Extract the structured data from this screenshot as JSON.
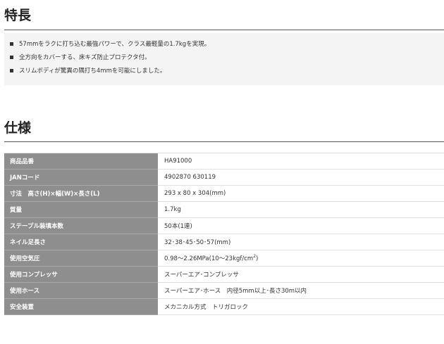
{
  "features": {
    "title": "特長",
    "items": [
      "57mmをラクに打ち込む最強パワーで、クラス最軽量の1.7kgを実現。",
      "全方向をカバーする、床キズ防止プロテクタ付。",
      "スリムボディが驚異の隅打ち4mmを可能にしました。"
    ]
  },
  "specs": {
    "title": "仕様",
    "rows": [
      {
        "label": "商品品番",
        "value": "HA91000"
      },
      {
        "label": "JANコード",
        "value": "4902870 630119"
      },
      {
        "label": "寸法　高さ(H)×幅(W)×長さ(L)",
        "value": "293 x 80 x 304(mm)"
      },
      {
        "label": "質量",
        "value": "1.7kg"
      },
      {
        "label": "ステープル装填本数",
        "value": "50本(1連)"
      },
      {
        "label": "ネイル足長さ",
        "value": "32･38･45･50･57(mm)"
      },
      {
        "label": "使用空気圧",
        "value": "0.98～2.26MPa(10～23kgf/cm",
        "value_sup": "2",
        "value_suffix": ")"
      },
      {
        "label": "使用コンプレッサ",
        "value": "スーパーエア･コンプレッサ"
      },
      {
        "label": "使用ホース",
        "value": "スーパーエア･ホース　内径5mm以上･長さ30m以内"
      },
      {
        "label": "安全装置",
        "value": "メカニカル方式　トリガロック"
      }
    ]
  }
}
